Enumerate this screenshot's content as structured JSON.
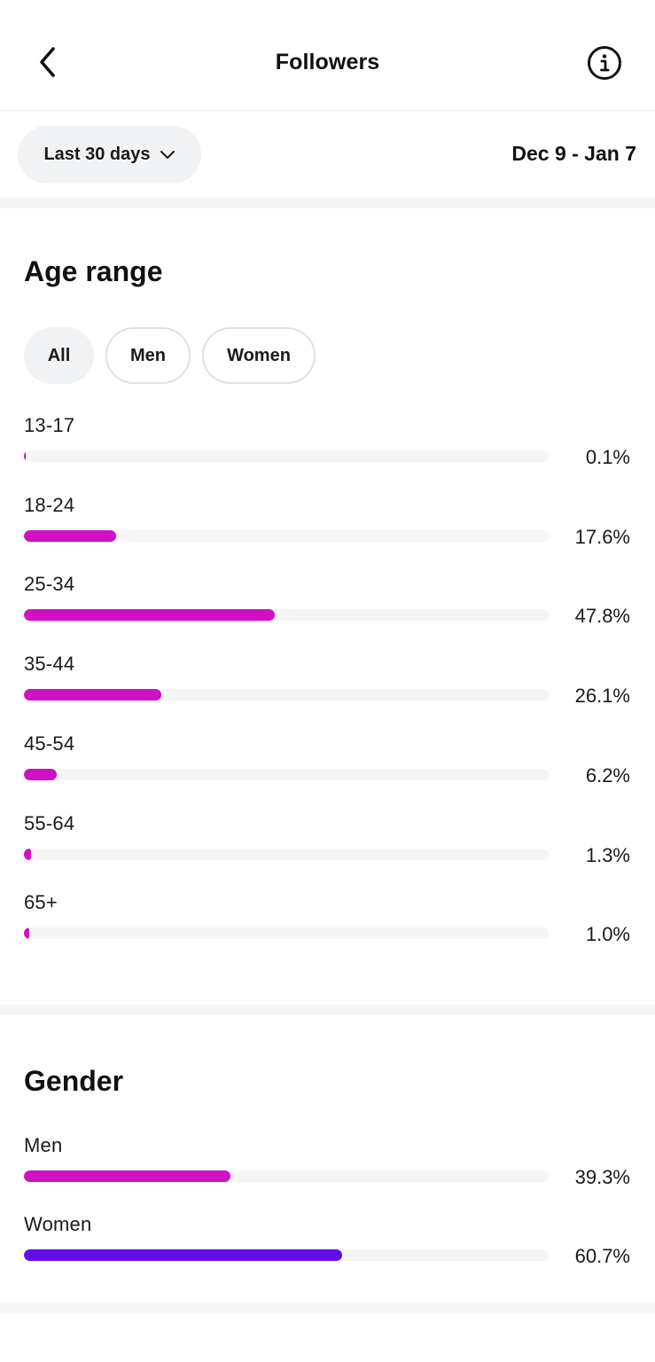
{
  "header": {
    "title": "Followers",
    "back_icon": "chevron-left-icon",
    "info_icon": "info-icon"
  },
  "filter": {
    "range_label": "Last 30 days",
    "dropdown_icon": "chevron-down-icon",
    "date_range": "Dec 9 - Jan 7"
  },
  "age": {
    "title": "Age range",
    "chips": [
      {
        "label": "All",
        "selected": true
      },
      {
        "label": "Men",
        "selected": false
      },
      {
        "label": "Women",
        "selected": false
      }
    ],
    "bar_color": "#d10fc5",
    "rows": [
      {
        "label": "13-17",
        "value": "0.1%",
        "percent": 0.1
      },
      {
        "label": "18-24",
        "value": "17.6%",
        "percent": 17.6
      },
      {
        "label": "25-34",
        "value": "47.8%",
        "percent": 47.8
      },
      {
        "label": "35-44",
        "value": "26.1%",
        "percent": 26.1
      },
      {
        "label": "45-54",
        "value": "6.2%",
        "percent": 6.2
      },
      {
        "label": "55-64",
        "value": "1.3%",
        "percent": 1.3
      },
      {
        "label": "65+",
        "value": "1.0%",
        "percent": 1.0
      }
    ]
  },
  "gender": {
    "title": "Gender",
    "rows": [
      {
        "label": "Men",
        "value": "39.3%",
        "percent": 39.3,
        "color": "#d10fc5"
      },
      {
        "label": "Women",
        "value": "60.7%",
        "percent": 60.7,
        "color": "#5f0fe4"
      }
    ]
  }
}
